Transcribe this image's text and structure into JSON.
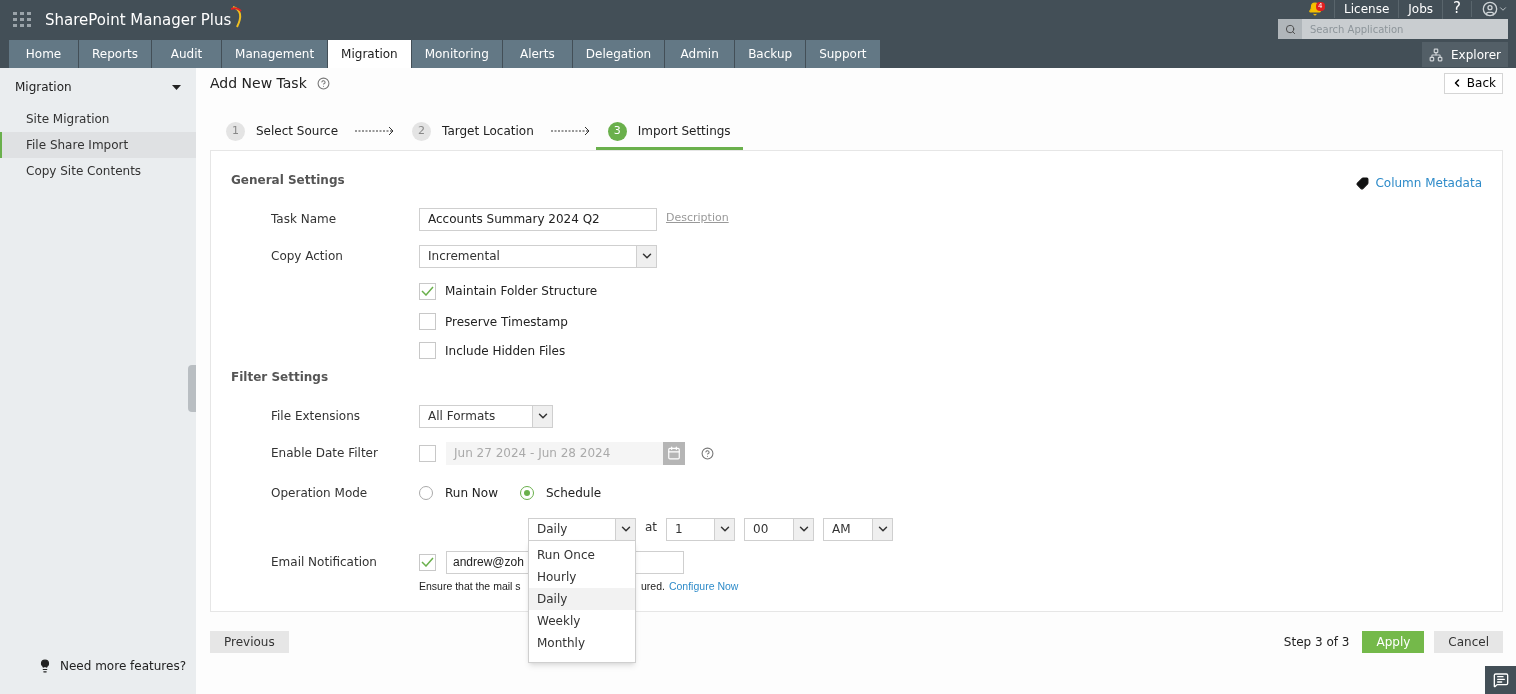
{
  "app": {
    "title": "SharePoint Manager Plus",
    "notification_count": "4",
    "links": [
      "License",
      "Jobs"
    ],
    "help": "?",
    "search": {
      "placeholder": "Search Application"
    },
    "explorer": "Explorer"
  },
  "tabs": [
    {
      "label": "Home",
      "selected": false
    },
    {
      "label": "Reports",
      "selected": false
    },
    {
      "label": "Audit",
      "selected": false
    },
    {
      "label": "Management",
      "selected": false
    },
    {
      "label": "Migration",
      "selected": true
    },
    {
      "label": "Monitoring",
      "selected": false
    },
    {
      "label": "Alerts",
      "selected": false
    },
    {
      "label": "Delegation",
      "selected": false
    },
    {
      "label": "Admin",
      "selected": false
    },
    {
      "label": "Backup",
      "selected": false
    },
    {
      "label": "Support",
      "selected": false
    }
  ],
  "sidebar": {
    "heading": "Migration",
    "expanded": true,
    "items": [
      {
        "label": "Site Migration",
        "selected": false
      },
      {
        "label": "File Share Import",
        "selected": true
      },
      {
        "label": "Copy Site Contents",
        "selected": false
      }
    ],
    "footer": "Need more features?"
  },
  "page": {
    "title": "Add New Task",
    "back": "Back"
  },
  "steps": [
    {
      "number": "1",
      "label": "Select Source",
      "selected": false
    },
    {
      "number": "2",
      "label": "Target Location",
      "selected": false
    },
    {
      "number": "3",
      "label": "Import Settings",
      "selected": true
    }
  ],
  "general": {
    "heading": "General Settings",
    "column_metadata": "Column Metadata",
    "task_name": {
      "label": "Task Name",
      "value": "Accounts Summary 2024 Q2",
      "link": "Description"
    },
    "copy_action": {
      "label": "Copy Action",
      "value": "Incremental"
    },
    "options": [
      {
        "label": "Maintain Folder Structure",
        "checked": true
      },
      {
        "label": "Preserve Timestamp",
        "checked": false
      },
      {
        "label": "Include Hidden Files",
        "checked": false
      }
    ]
  },
  "filter": {
    "heading": "Filter Settings",
    "file_extensions": {
      "label": "File Extensions",
      "value": "All Formats"
    },
    "date_filter": {
      "label": "Enable Date Filter",
      "checked": false,
      "value": "Jun 27 2024 - Jun 28 2024"
    },
    "operation_mode": {
      "label": "Operation Mode",
      "options": [
        {
          "label": "Run Now",
          "selected": false
        },
        {
          "label": "Schedule",
          "selected": true
        }
      ]
    },
    "schedule": {
      "frequency": "Daily",
      "at": "at",
      "hour": "1",
      "minute": "00",
      "period": "AM",
      "menu": [
        {
          "label": "Run Once",
          "selected": false
        },
        {
          "label": "Hourly",
          "selected": false
        },
        {
          "label": "Daily",
          "selected": true
        },
        {
          "label": "Weekly",
          "selected": false
        },
        {
          "label": "Monthly",
          "selected": false
        }
      ]
    },
    "email": {
      "label": "Email Notification",
      "checked": true,
      "value": "andrew@zoh",
      "hint_start": "Ensure that the mail s",
      "hint_end": "ured.",
      "link": "Configure Now"
    }
  },
  "footer": {
    "previous": "Previous",
    "step": "Step 3 of 3",
    "apply": "Apply",
    "cancel": "Cancel"
  }
}
